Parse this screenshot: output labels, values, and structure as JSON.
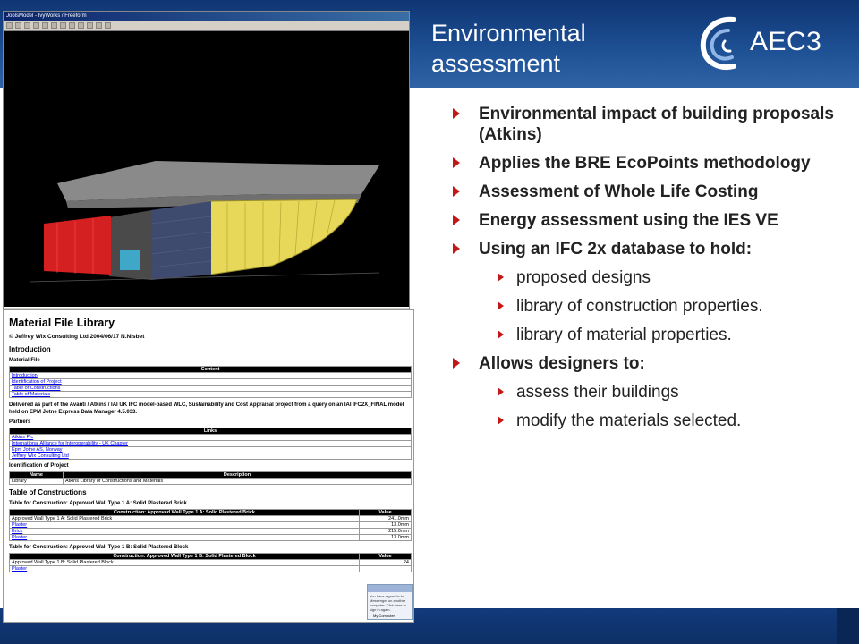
{
  "slide": {
    "title": "Environmental assessment",
    "logo_text": "AEC3",
    "colors": {
      "header": "#1d4f93",
      "bullet_arrow": "#c21818",
      "footer": "#123a7a"
    }
  },
  "viewer": {
    "window_title": "JoolsModel - IvyWorks / Freeform"
  },
  "bullets": [
    {
      "level": 1,
      "text": "Environmental impact of building proposals (Atkins)"
    },
    {
      "level": 1,
      "text": "Applies the BRE EcoPoints methodology"
    },
    {
      "level": 1,
      "text": "Assessment of Whole Life Costing"
    },
    {
      "level": 1,
      "text": "Energy assessment using the IES VE"
    },
    {
      "level": 1,
      "text": "Using an IFC 2x database to hold:"
    },
    {
      "level": 2,
      "text": "proposed designs"
    },
    {
      "level": 2,
      "text": "library of construction properties."
    },
    {
      "level": 2,
      "text": "library of material properties."
    },
    {
      "level": 1,
      "text": "Allows designers to:"
    },
    {
      "level": 2,
      "text": "assess their buildings"
    },
    {
      "level": 2,
      "text": "modify the materials selected."
    }
  ],
  "library": {
    "title": "Material File Library",
    "copyright": "© Jeffrey Wix Consulting Ltd 2004/06/17 N.Nisbet",
    "intro_heading": "Introduction",
    "material_file_label": "Material File",
    "content_header": "Content",
    "content_links": [
      "Introduction",
      "Identification of Project",
      "Table of Constructions",
      "Table of Materials"
    ],
    "delivered_text": "Delivered as part of the Avanti / Atkins / IAI UK IFC model-based WLC, Sustainability and Cost Appraisal project from a query on an IAI IFC2X_FINAL model held on EPM Jotne Express Data Manager 4.5.033.",
    "partners_label": "Partners",
    "links_header": "Links",
    "partner_links": [
      "Atkins Plc",
      "International Alliance for Interoperability - UK Chapter",
      "Epm Jotne AS, Norway",
      "Jeffrey Wix Consulting Ltd"
    ],
    "identification_heading": "Identification of Project",
    "id_table": {
      "headers": [
        "Name",
        "Description"
      ],
      "row": [
        "Library",
        "Atkins Library of Constructions and Materials"
      ]
    },
    "constructions_heading": "Table of Constructions",
    "construction_a": {
      "caption": "Table for Construction: Approved Wall Type 1 A: Solid Plastered Brick",
      "headers": [
        "Construction: Approved Wall Type 1 A: Solid Plastered Brick",
        "Value"
      ],
      "rows": [
        [
          "Approved Wall Type 1 A: Solid Plastered Brick",
          "241.0mm"
        ],
        [
          "Plaster",
          "13.0mm"
        ],
        [
          "Brick",
          "215.0mm"
        ],
        [
          "Plaster",
          "13.0mm"
        ]
      ]
    },
    "construction_b": {
      "caption": "Table for Construction: Approved Wall Type 1 B: Solid Plastered Block",
      "headers": [
        "Construction: Approved Wall Type 1 B: Solid Plastered Block",
        "Value"
      ],
      "rows": [
        [
          "Approved Wall Type 1 B: Solid Plastered Block",
          "24"
        ],
        [
          "Plaster",
          ""
        ]
      ]
    },
    "popup_title": "NTS Messenger",
    "popup_text": "You have signed in to Messenger on another computer. Click here to sign in again.",
    "status_text": "My Computer"
  }
}
